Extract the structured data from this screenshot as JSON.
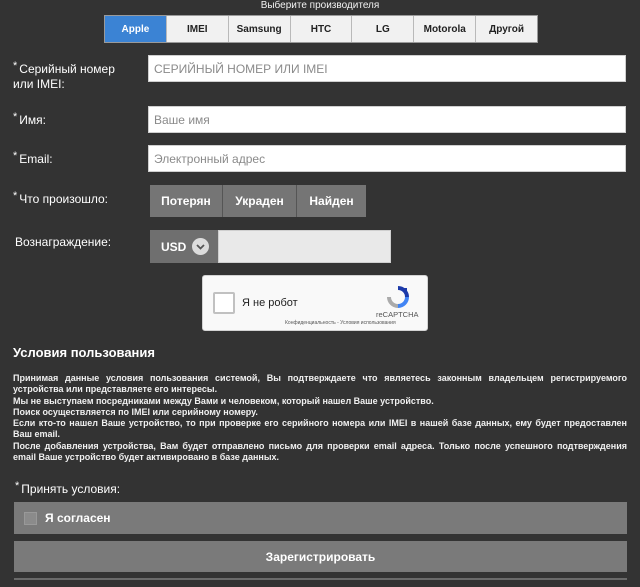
{
  "manufacturer": {
    "title": "Выберите производителя",
    "tabs": [
      "Apple",
      "IMEI",
      "Samsung",
      "HTC",
      "LG",
      "Motorola",
      "Другой"
    ],
    "active": "Apple"
  },
  "form": {
    "serial": {
      "label_line1": "Серийный номер",
      "label_line2": "или IMEI:",
      "placeholder": "СЕРИЙНЫЙ НОМЕР ИЛИ IMEI"
    },
    "name": {
      "label": "Имя:",
      "placeholder": "Ваше имя"
    },
    "email": {
      "label": "Email:",
      "placeholder": "Электронный адрес"
    },
    "status": {
      "label": "Что произошло:",
      "options": [
        "Потерян",
        "Украден",
        "Найден"
      ]
    },
    "reward": {
      "label": "Вознаграждение:",
      "currency": "USD"
    },
    "required_mark": "*"
  },
  "captcha": {
    "label": "Я не робот",
    "brand": "reCAPTCHA",
    "links": "Конфиденциальность - Условия использования"
  },
  "terms": {
    "title": "Условия пользования",
    "paragraphs": [
      "Принимая данные условия пользования системой, Вы подтверждаете что являетесь законным владельцем регистрируемого устройства или представляете его интересы.",
      "Мы не выступаем посредниками между Вами и человеком, который нашел Ваше устройство.",
      "Поиск осуществляется по IMEI или серийному номеру.",
      "Если кто-то нашел Ваше устройство, то при проверке его серийного номера или IMEI в нашей базе данных, ему будет предоставлен Ваш email.",
      "После добавления устройства, Вам будет отправлено письмо для проверки email адреса. Только после успешного подтверждения email Ваше устройство будет активировано в базе данных."
    ]
  },
  "accept": {
    "label": "Принять условия:",
    "checkbox_label": "Я согласен"
  },
  "submit_label": "Зарегистрировать",
  "colors": {
    "background": "#333333",
    "accent": "#3b83d4",
    "button": "#757575"
  }
}
